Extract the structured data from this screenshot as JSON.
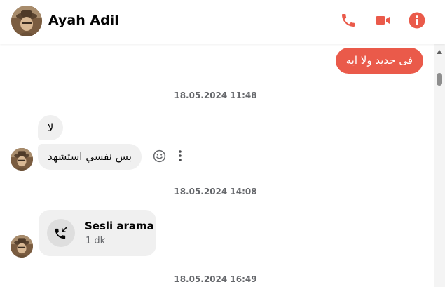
{
  "header": {
    "contact_name": "Ayah Adil",
    "actions": {
      "phone_icon": "phone-icon",
      "video_icon": "video-camera-icon",
      "info_icon": "info-icon"
    }
  },
  "colors": {
    "accent": "#ea5a4a",
    "incoming_bubble": "#f0f0f0",
    "timestamp_text": "#65676b"
  },
  "messages": {
    "outgoing_1": "فى جديد ولا ايه",
    "timestamp_1": "18.05.2024 11:48",
    "incoming_1": "لا",
    "incoming_2": "بس نفسي استشهد",
    "timestamp_2": "18.05.2024 14:08",
    "call": {
      "title": "Sesli arama",
      "duration": "1 dk",
      "icon": "incoming-call-icon"
    },
    "timestamp_3": "18.05.2024 16:49"
  },
  "message_actions": {
    "react_icon": "smiley-icon",
    "more_icon": "more-vertical-icon"
  }
}
